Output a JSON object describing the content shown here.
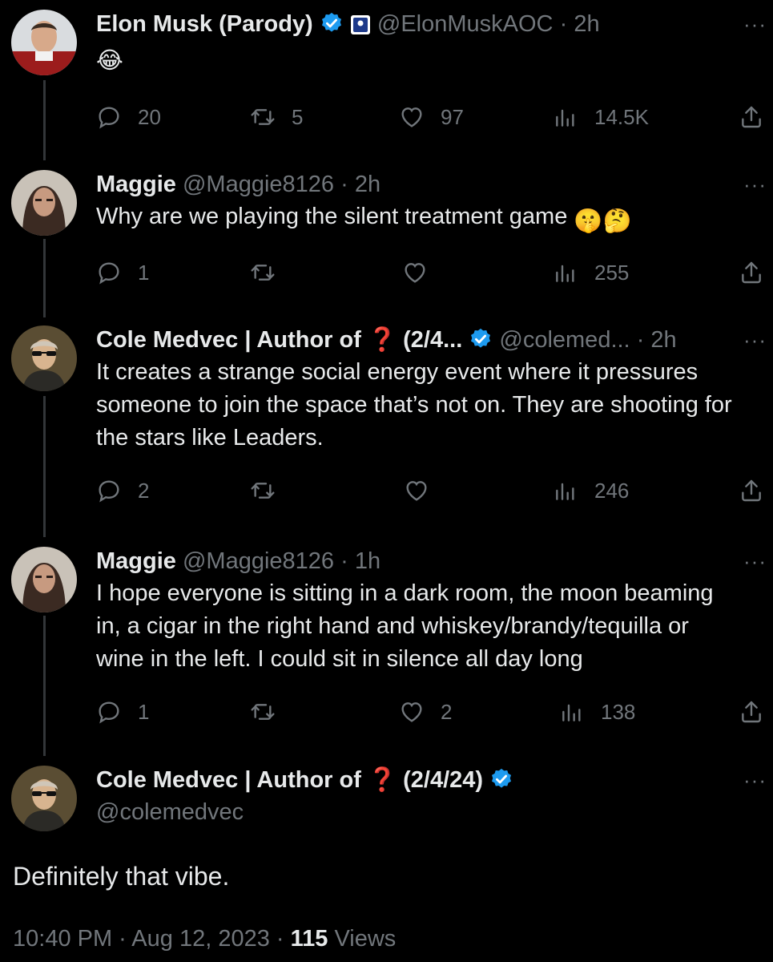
{
  "colors": {
    "background": "#000000",
    "text": "#e7e9ea",
    "muted": "#71767b",
    "verified": "#1d9bf0",
    "thread_line": "#333639"
  },
  "tweets": [
    {
      "name": "Elon Musk (Parody)",
      "handle": "@ElonMuskAOC",
      "separator": "·",
      "time": "2h",
      "text": "",
      "emoji": "😂",
      "verified": true,
      "affiliate_badge": true,
      "replies": "20",
      "retweets": "5",
      "likes": "97",
      "views": "14.5K"
    },
    {
      "name": "Maggie",
      "handle": "@Maggie8126",
      "separator": "·",
      "time": "2h",
      "text": "Why are we playing the silent treatment game",
      "emoji": "🤫🤔",
      "verified": false,
      "replies": "1",
      "retweets": "",
      "likes": "",
      "views": "255"
    },
    {
      "name": "Cole Medvec | Author of ❓ (2/4...",
      "handle": "@colemed...",
      "separator": "·",
      "time": "2h",
      "text": "It creates a strange social energy event where it pressures someone to join the space that’s not on. They are shooting for the stars like Leaders.",
      "verified": true,
      "replies": "2",
      "retweets": "",
      "likes": "",
      "views": "246"
    },
    {
      "name": "Maggie",
      "handle": "@Maggie8126",
      "separator": "·",
      "time": "1h",
      "text": "I hope everyone is sitting in a dark room, the moon beaming in, a cigar in the right hand and whiskey/brandy/tequilla or wine in the left. I could sit in silence all day long",
      "verified": false,
      "replies": "1",
      "retweets": "",
      "likes": "2",
      "views": "138"
    }
  ],
  "main_tweet": {
    "name": "Cole Medvec | Author of ❓ (2/4/24)",
    "handle": "@colemedvec",
    "text": "Definitely that vibe.",
    "timestamp": "10:40 PM · Aug 12, 2023 · ",
    "views_count": "115",
    "views_label": " Views"
  },
  "more_label": "···",
  "icons": [
    "reply-icon",
    "retweet-icon",
    "like-icon",
    "views-icon",
    "share-icon",
    "verified-icon",
    "more-icon"
  ]
}
